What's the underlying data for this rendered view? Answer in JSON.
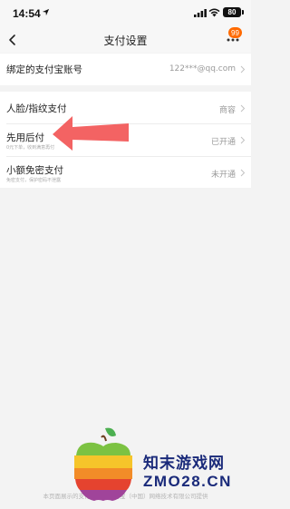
{
  "status_bar": {
    "time": "14:54",
    "battery": "80"
  },
  "nav": {
    "title": "支付设置",
    "badge": "99"
  },
  "account": {
    "label": "绑定的支付宝账号",
    "value": "122***@qq.com"
  },
  "settings": [
    {
      "label": "人脸/指纹支付",
      "value": "商容"
    },
    {
      "label": "先用后付",
      "sub": "0元下单，收到满意再付",
      "value": "已开通"
    },
    {
      "label": "小额免密支付",
      "sub": "免密支付，保护密码不泄露",
      "value": "未开通"
    }
  ],
  "footer": "本页面展示的支付功能由支付宝（中国）网络技术有限公司提供",
  "watermark": {
    "name": "知末游戏网",
    "domain": "ZMO28.CN"
  },
  "colors": {
    "accent": "#ff6a00",
    "arrow": "#f25b5b",
    "watermark": "#1a2a7a"
  }
}
